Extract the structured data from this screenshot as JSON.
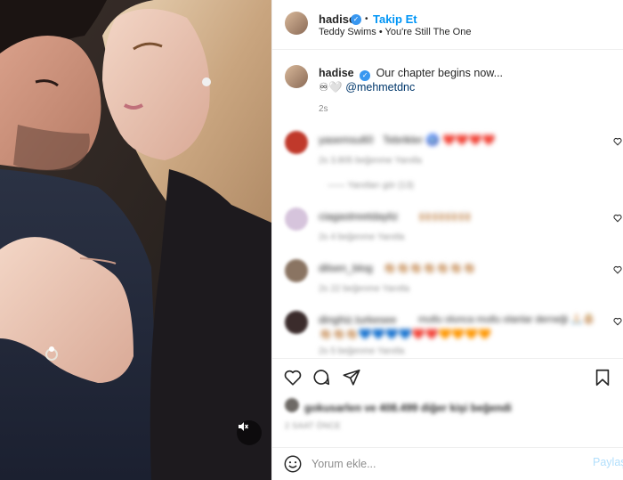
{
  "header": {
    "username": "hadise",
    "verified_icon": "verified-badge-icon",
    "separator": "•",
    "follow_label": "Takip Et",
    "audio": "Teddy Swims • You're Still The One"
  },
  "caption": {
    "username": "hadise",
    "text": "Our chapter begins now...",
    "emoji_line": "♾🤍",
    "mention": "@mehmetdnc",
    "time": "2s"
  },
  "comments": [
    {
      "username": "yasemsu60",
      "text": "Tebrikler 🧿 ❤️❤️❤️❤️",
      "meta": "2s   3.805 beğenme   Yanıtla",
      "replies": "—— Yanıtları gör (13)"
    },
    {
      "username": "ciagastreetdayliz",
      "text": "🙌🏼🙌🏼🙌🏼🙌🏼",
      "meta": "2s   4 beğenme   Yanıtla"
    },
    {
      "username": "dilsen_blog",
      "text": "👏🏼👏🏼👏🏼👏🏼👏🏼👏🏼👏🏼",
      "meta": "2s   22 beğenme   Yanıtla"
    },
    {
      "username": "dinghiz.turkesee",
      "text": "mutlu olunca mutlu olanlar derneği 🙏🏻👶🏼",
      "text2": "👏🏼👏🏼👏🏼💙💙💙💙❤️❤️🧡🧡🧡🧡",
      "meta": "2s   5 beğenme   Yanıtla"
    }
  ],
  "actions": {
    "likes": "gokusarlen ve 408.499 diğer kişi beğendi",
    "ago": "2 SAAT ÖNCE"
  },
  "add_comment": {
    "placeholder": "Yorum ekle...",
    "post_label": "Paylaş"
  },
  "colors": {
    "link_blue": "#0095f6",
    "verified_blue": "#3897f0",
    "post_disabled": "#b2dffc",
    "muted_text": "#8e8e8e"
  }
}
